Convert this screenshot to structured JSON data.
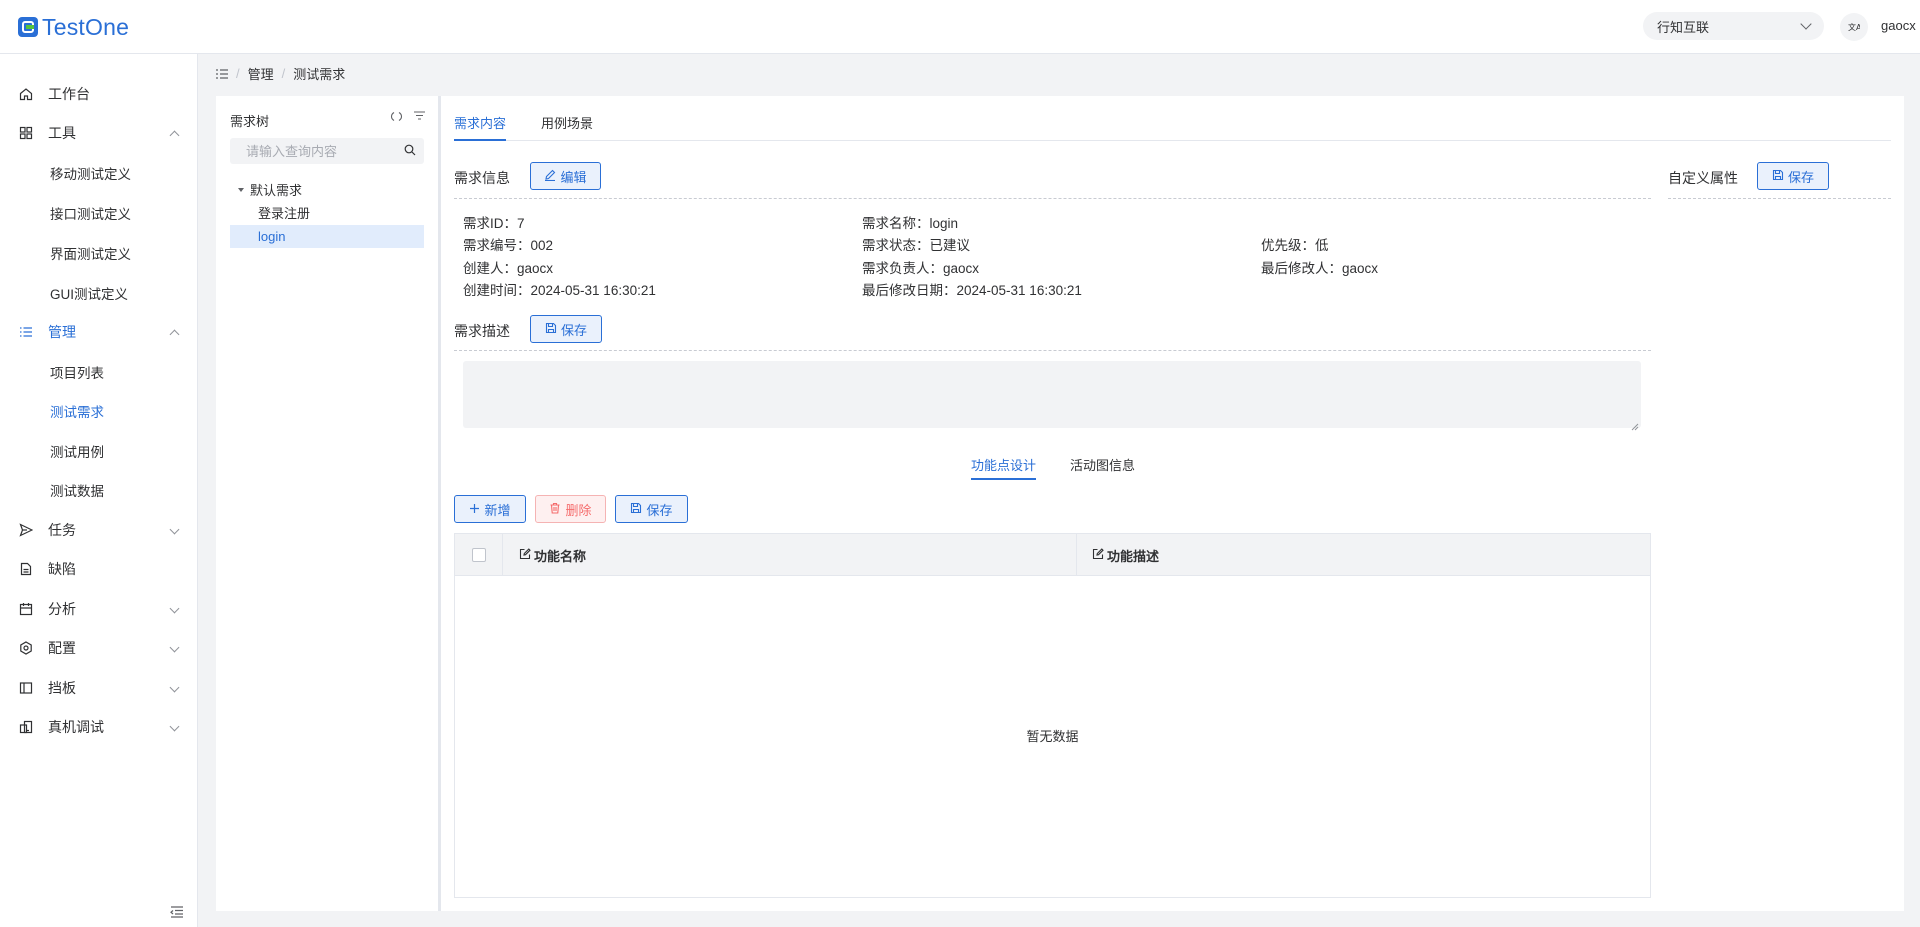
{
  "app": {
    "logo_text": "TestOne",
    "brand_color": "#2a6fd6"
  },
  "header": {
    "org_selector": "行知互联",
    "lang_icon": "translate-icon",
    "user": "gaocx"
  },
  "sidebar": {
    "items": [
      {
        "label": "工作台",
        "icon": "home-icon"
      },
      {
        "label": "工具",
        "icon": "grid-icon",
        "expanded": true,
        "children": [
          "移动测试定义",
          "接口测试定义",
          "界面测试定义",
          "GUI测试定义"
        ]
      },
      {
        "label": "管理",
        "icon": "list-icon",
        "expanded": true,
        "active": true,
        "children": [
          "项目列表",
          "测试需求",
          "测试用例",
          "测试数据"
        ],
        "active_child": "测试需求"
      },
      {
        "label": "任务",
        "icon": "send-icon"
      },
      {
        "label": "缺陷",
        "icon": "document-icon"
      },
      {
        "label": "分析",
        "icon": "calendar-icon"
      },
      {
        "label": "配置",
        "icon": "gear-icon"
      },
      {
        "label": "挡板",
        "icon": "panel-icon"
      },
      {
        "label": "真机调试",
        "icon": "device-icon"
      }
    ]
  },
  "breadcrumb": [
    "管理",
    "测试需求"
  ],
  "tree": {
    "title": "需求树",
    "search_placeholder": "请输入查询内容",
    "nodes": [
      {
        "label": "默认需求",
        "level": 0
      },
      {
        "label": "登录注册",
        "level": 1
      },
      {
        "label": "login",
        "level": 1,
        "selected": true
      }
    ]
  },
  "main": {
    "tabs": [
      "需求内容",
      "用例场景"
    ],
    "active_tab": "需求内容",
    "info_section": {
      "title": "需求信息",
      "edit_label": "编辑"
    },
    "custom_section": {
      "title": "自定义属性",
      "save_label": "保存"
    },
    "fields": {
      "id": "需求ID：7",
      "name": "需求名称：login",
      "code": "需求编号：002",
      "status": "需求状态：已建议",
      "priority": "优先级：低",
      "creator": "创建人：gaocx",
      "owner": "需求负责人：gaocx",
      "modifier": "最后修改人：gaocx",
      "created": "创建时间：2024-05-31 16:30:21",
      "modified": "最后修改日期：2024-05-31 16:30:21"
    },
    "desc_section": {
      "title": "需求描述",
      "save_label": "保存"
    },
    "sub_tabs": [
      "功能点设计",
      "活动图信息"
    ],
    "active_sub_tab": "功能点设计",
    "actions": {
      "add": "新增",
      "delete": "删除",
      "save": "保存"
    },
    "table": {
      "columns": [
        "功能名称",
        "功能描述"
      ],
      "rows": [],
      "empty_text": "暂无数据"
    }
  }
}
